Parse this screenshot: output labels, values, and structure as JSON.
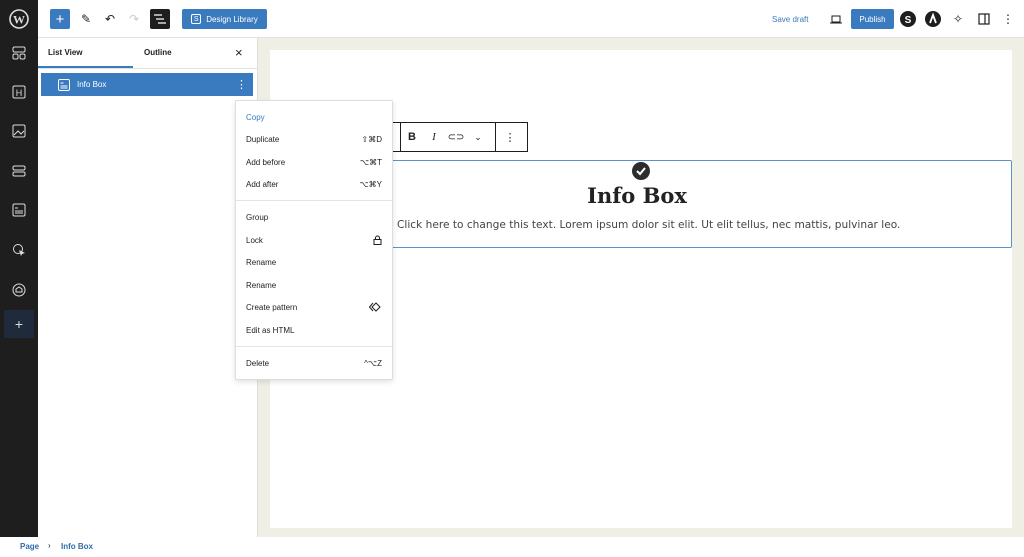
{
  "topbar": {
    "design_library": "Design Library",
    "save_draft": "Save draft",
    "publish": "Publish"
  },
  "panel": {
    "tabs": [
      "List View",
      "Outline"
    ],
    "close": "×",
    "item": "Info Box"
  },
  "menu": {
    "items": [
      {
        "label": "Copy",
        "shortcut": ""
      },
      {
        "label": "Duplicate",
        "shortcut": "⇧⌘D"
      },
      {
        "label": "Add before",
        "shortcut": "⌥⌘T"
      },
      {
        "label": "Add after",
        "shortcut": "⌥⌘Y"
      },
      {
        "label": "Group",
        "shortcut": ""
      },
      {
        "label": "Lock",
        "shortcut": ""
      },
      {
        "label": "Rename",
        "shortcut": ""
      },
      {
        "label": "Rename",
        "shortcut": ""
      },
      {
        "label": "Create pattern",
        "shortcut": ""
      },
      {
        "label": "Edit as HTML",
        "shortcut": ""
      },
      {
        "label": "Delete",
        "shortcut": "^⌥Z"
      }
    ]
  },
  "toolbar": {
    "bold": "B",
    "italic": "I"
  },
  "block": {
    "title": "Info Box",
    "text": "Click here to change this text. Lorem ipsum dolor sit elit. Ut elit tellus, nec mattis, pulvinar leo."
  },
  "breadcrumb": {
    "root": "Page",
    "sep": "›",
    "current": "Info Box"
  },
  "colors": {
    "accent": "#3a7bbf",
    "sidebar": "#1e1e1e",
    "canvas": "#f0efe6"
  }
}
